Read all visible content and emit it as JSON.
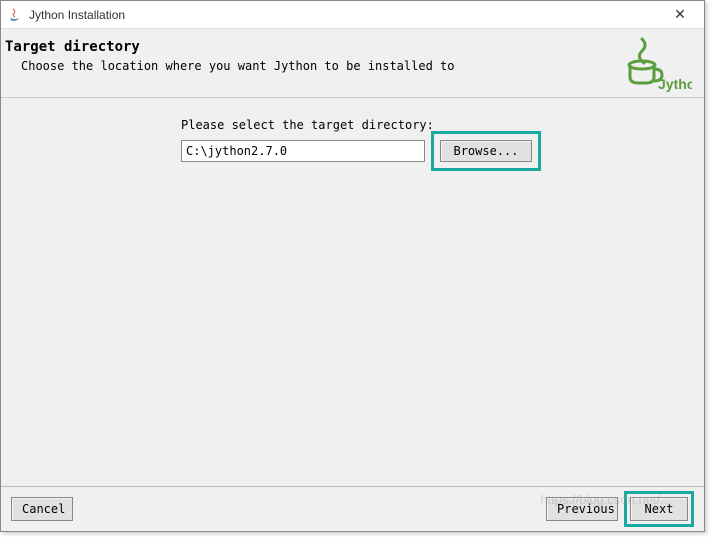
{
  "window": {
    "title": "Jython Installation",
    "close_glyph": "✕"
  },
  "header": {
    "title": "Target directory",
    "subtitle": "Choose the location where you want Jython to be installed to",
    "logo_text": "Jython"
  },
  "main": {
    "prompt": "Please select the target directory:",
    "path_value": "C:\\jython2.7.0",
    "browse_label": "Browse..."
  },
  "footer": {
    "cancel_label": "Cancel",
    "previous_label": "Previous",
    "next_label": "Next"
  },
  "watermark": "https://blog.csdn.net/..."
}
